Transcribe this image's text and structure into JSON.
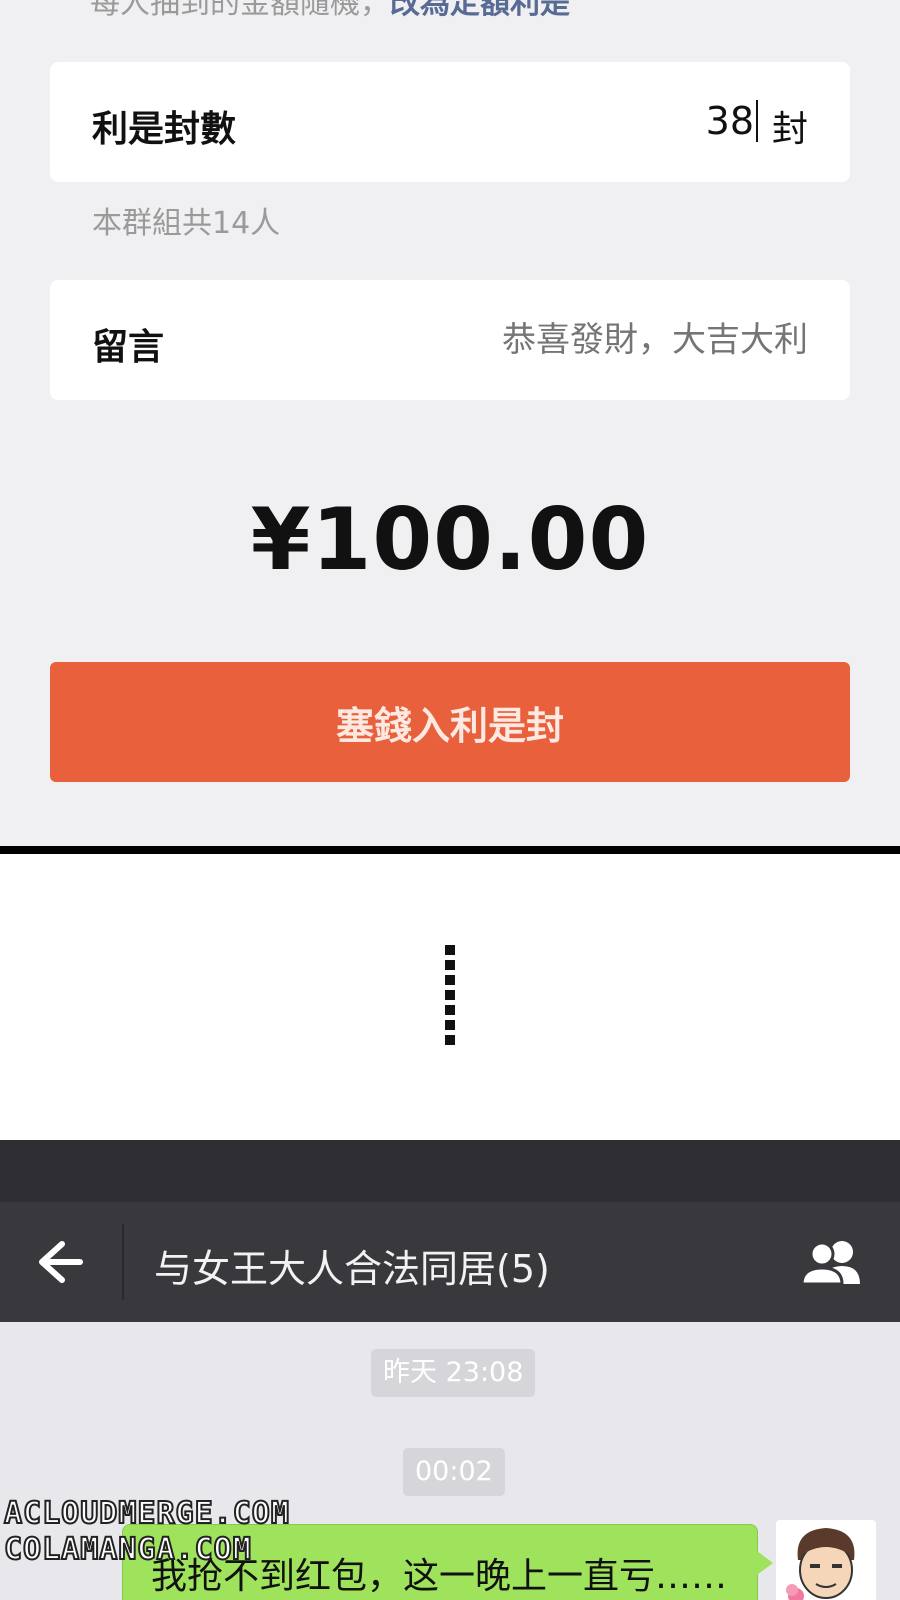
{
  "form": {
    "cut_text": "每人抽到的金額隨機，",
    "cut_link": "改為定額利是",
    "count_label": "利是封數",
    "count_value": "38",
    "count_unit": "封",
    "group_hint": "本群組共14人",
    "message_label": "留言",
    "message_placeholder": "恭喜發財，大吉大利",
    "amount": "¥100.00",
    "submit_label": "塞錢入利是封"
  },
  "chat": {
    "title": "与女王大人合法同居(5)",
    "timestamps": [
      "昨天 23:08",
      "00:02"
    ],
    "message_text": "我抢不到红包，这一晚上一直亏……",
    "back_icon": "arrow-left-icon",
    "members_icon": "group-members-icon"
  },
  "watermark": {
    "line1": "ACLOUDMERGE.COM",
    "line2": "COLAMANGA.COM"
  },
  "colors": {
    "accent_button": "#e8603c",
    "chat_bubble": "#9fe35c",
    "nav_bar": "#39393d"
  }
}
